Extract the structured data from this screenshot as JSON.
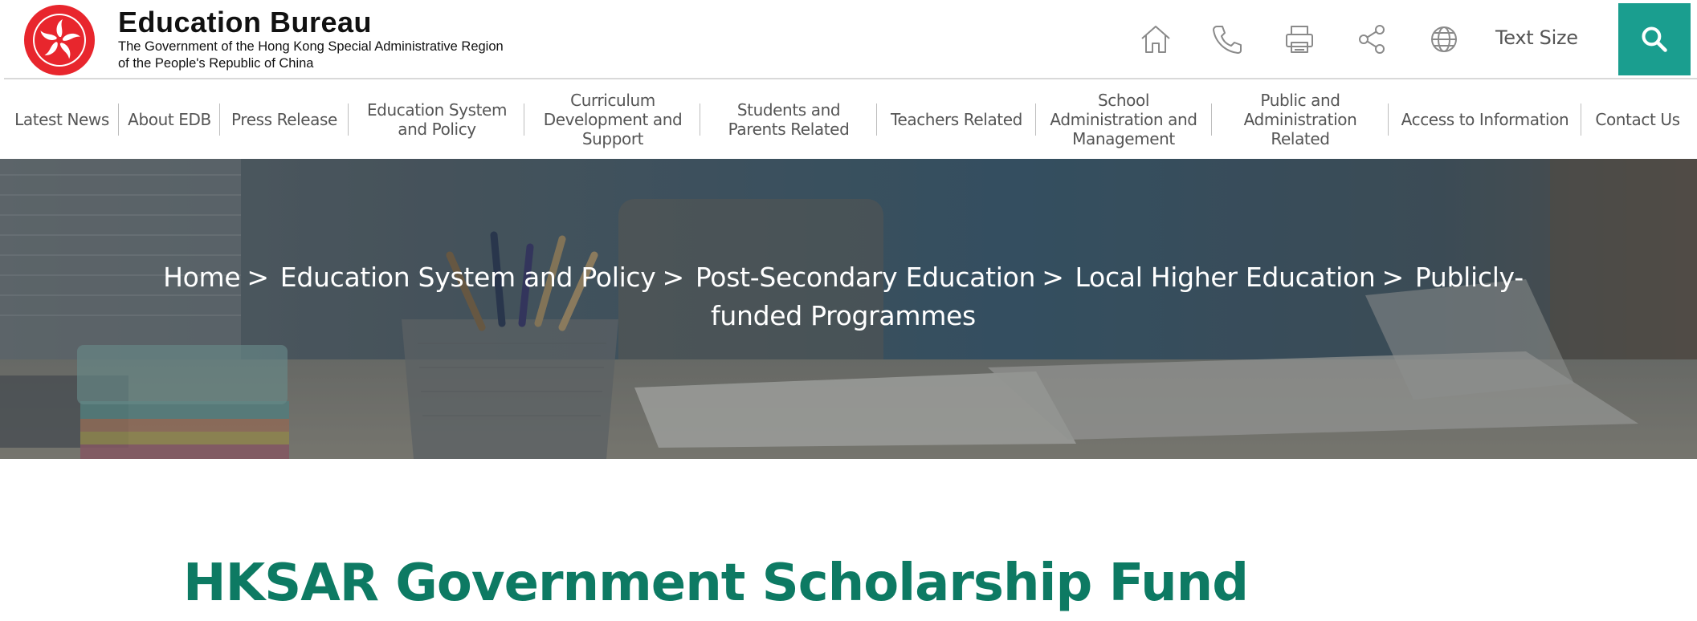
{
  "header": {
    "title": "Education Bureau",
    "subtitle_line1": "The Government of the Hong Kong Special Administrative Region",
    "subtitle_line2": "of the People's Republic of China",
    "logo_icon": "hksar-emblem-icon",
    "toolbar": {
      "icons": [
        "home-icon",
        "phone-icon",
        "print-icon",
        "share-icon",
        "globe-icon"
      ],
      "text_size_label": "Text Size",
      "search_icon": "search-icon",
      "accent_color": "#1a9e8f"
    }
  },
  "nav": {
    "items": [
      {
        "label": "Latest News"
      },
      {
        "label": "About EDB"
      },
      {
        "label": "Press Release"
      },
      {
        "label": "Education System and Policy"
      },
      {
        "label": "Curriculum Development and Support"
      },
      {
        "label": "Students and Parents Related"
      },
      {
        "label": "Teachers Related"
      },
      {
        "label": "School Administration and Management"
      },
      {
        "label": "Public and Administration Related"
      },
      {
        "label": "Access to Information"
      },
      {
        "label": "Contact Us"
      }
    ]
  },
  "breadcrumb": {
    "items": [
      "Home",
      "Education System and Policy",
      "Post-Secondary Education",
      "Local Higher Education",
      "Publicly-funded Programmes"
    ],
    "separator": ">"
  },
  "main": {
    "page_title": "HKSAR Government Scholarship Fund",
    "title_color": "#0d7a63"
  }
}
